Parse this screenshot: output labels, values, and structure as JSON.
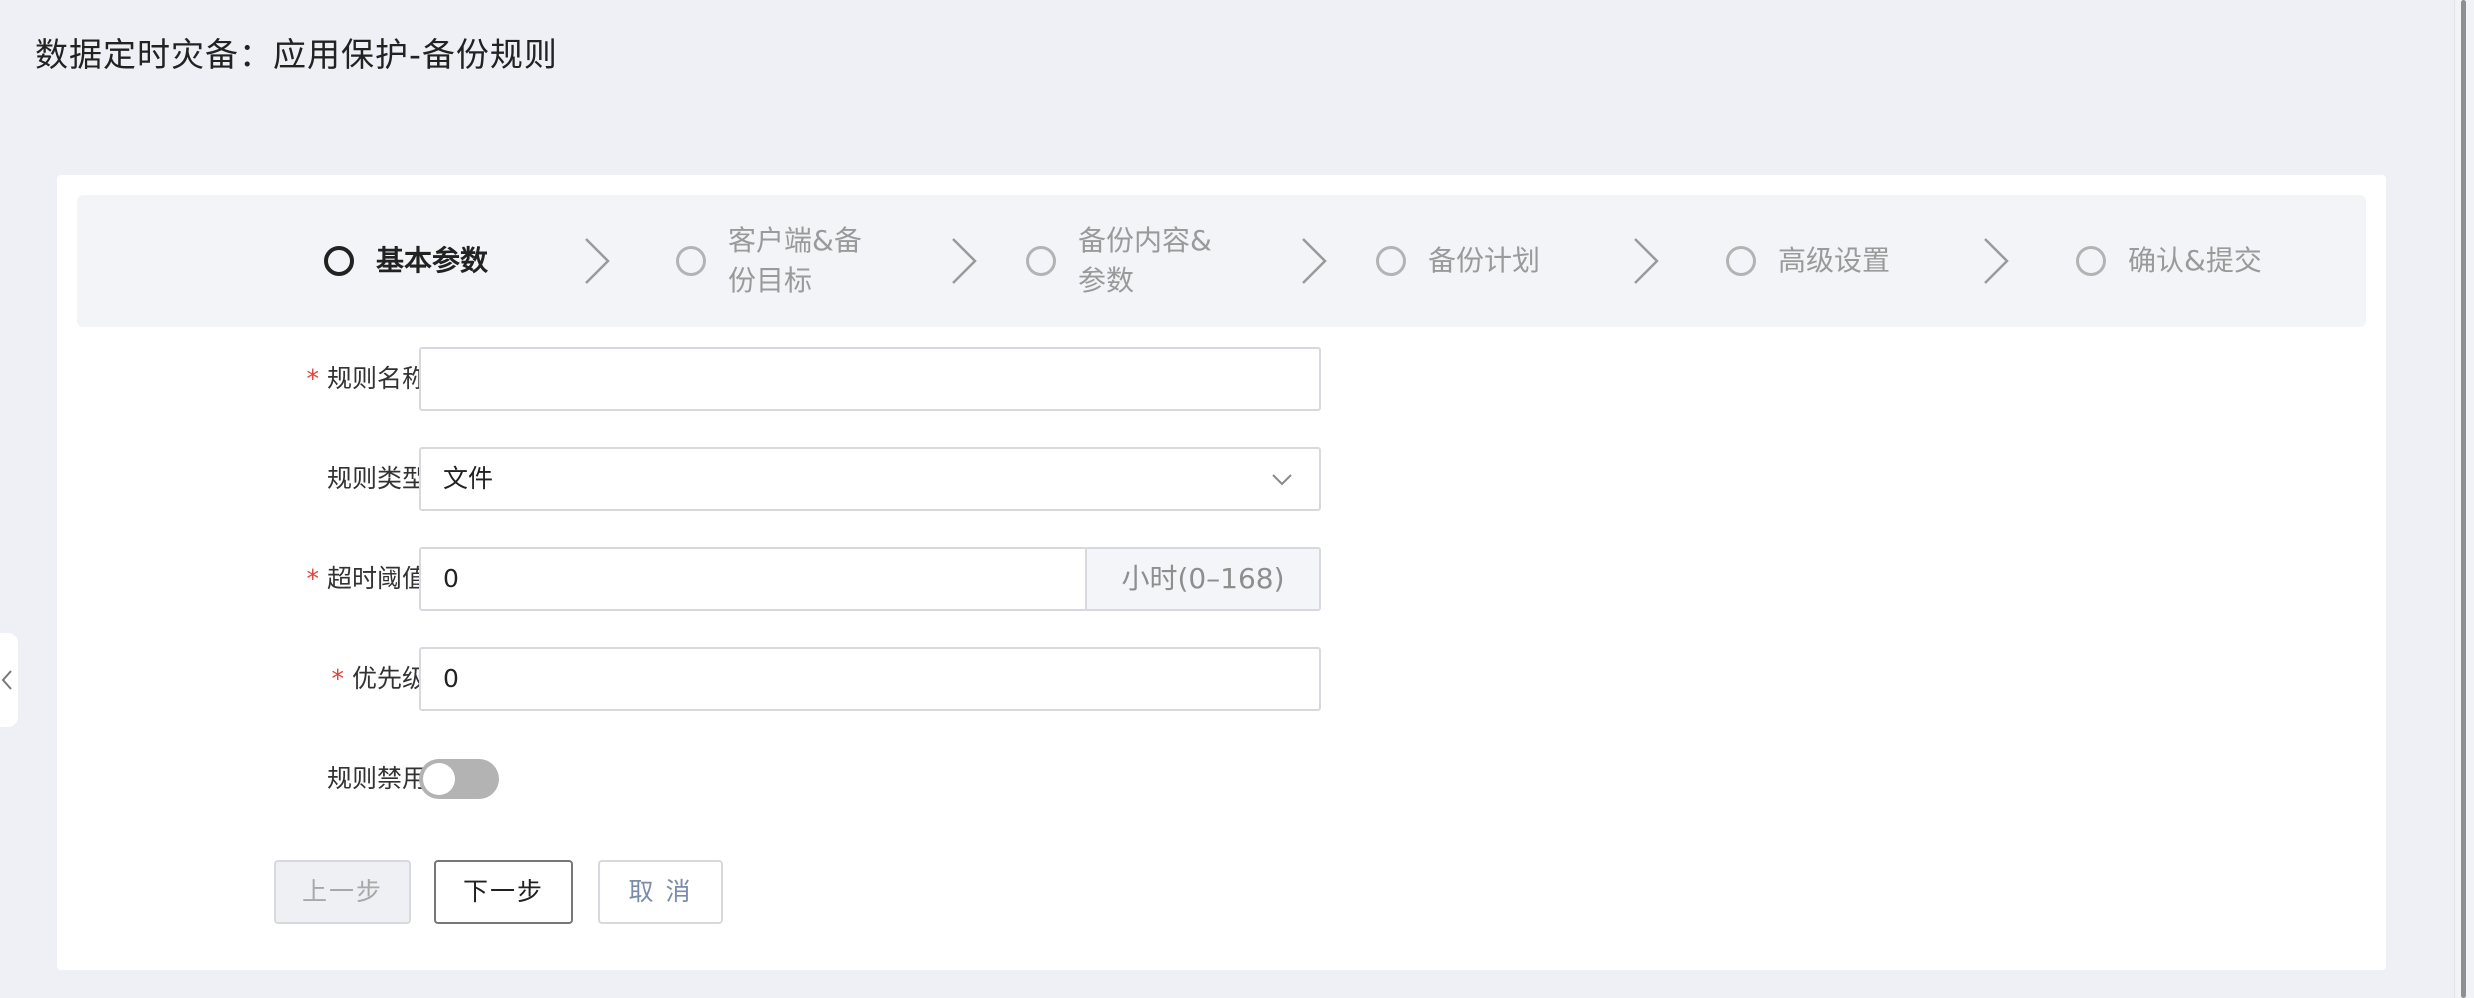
{
  "page": {
    "title": "数据定时灾备：应用保护-备份规则"
  },
  "steps": [
    {
      "label": "基本参数",
      "active": true
    },
    {
      "label": "客户端&备\n份目标",
      "active": false
    },
    {
      "label": "备份内容&\n参数",
      "active": false
    },
    {
      "label": "备份计划",
      "active": false
    },
    {
      "label": "高级设置",
      "active": false
    },
    {
      "label": "确认&提交",
      "active": false
    }
  ],
  "form": {
    "rule_name": {
      "label": "规则名称",
      "required": "*",
      "value": ""
    },
    "rule_type": {
      "label": "规则类型",
      "value": "文件"
    },
    "timeout": {
      "label": "超时阈值",
      "required": "*",
      "value": "0",
      "suffix": "小时(0–168)"
    },
    "priority": {
      "label": "优先级",
      "required": "*",
      "value": "0"
    },
    "rule_disabled": {
      "label": "规则禁用",
      "on": false
    }
  },
  "buttons": {
    "prev": "上一步",
    "next": "下一步",
    "cancel": "取 消"
  },
  "icons": {
    "step_arrow": "chevron-right-icon",
    "select": "chevron-down-icon",
    "collapse": "chevron-left-icon"
  },
  "colors": {
    "required": "#e0413a",
    "background": "#eef0f5",
    "step_bar": "#f3f4f8",
    "toggle_off": "#b3b3b3"
  }
}
